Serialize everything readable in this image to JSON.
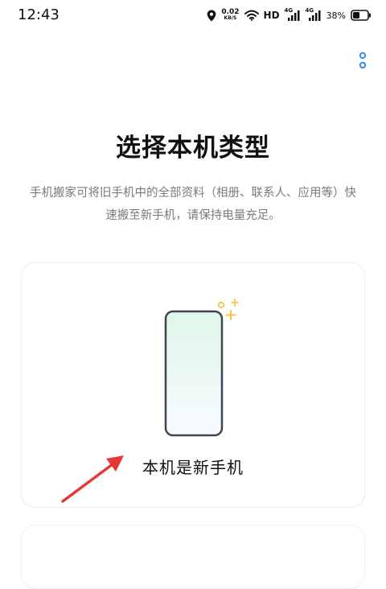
{
  "status_bar": {
    "time": "12:43",
    "net_speed_value": "0.02",
    "net_speed_unit": "KB/S",
    "hd_label": "HD",
    "signal1_tag": "4G",
    "signal2_tag": "4G",
    "battery_percent": "38%"
  },
  "page": {
    "title": "选择本机类型",
    "description": "手机搬家可将旧手机中的全部资料（相册、联系人、应用等）快速搬至新手机，请保持电量充足。"
  },
  "options": [
    {
      "label": "本机是新手机"
    }
  ],
  "colors": {
    "accent_blue": "#3b8cf0",
    "sparkle_yellow": "#f5c542",
    "annotation_red": "#e53935",
    "phone_frame": "#3d4650"
  }
}
